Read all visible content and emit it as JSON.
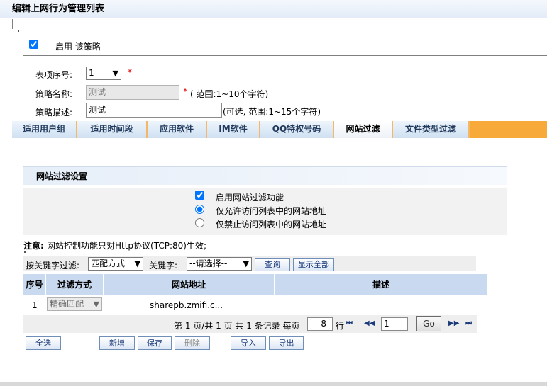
{
  "page": {
    "title": "编辑上网行为管理列表"
  },
  "policy": {
    "enable_checked": true,
    "enable_label": "启用 该策略",
    "index_label": "表项序号:",
    "index_value": "1",
    "required_mark": "*",
    "name_label": "策略名称:",
    "name_value": "测试",
    "name_hint": "( 范围:1~10个字符)",
    "desc_label": "策略描述:",
    "desc_value": "测试",
    "desc_hint": "(可选, 范围:1~15个字符)"
  },
  "tabs": [
    {
      "label": "适用用户组",
      "active": false
    },
    {
      "label": "适用时间段",
      "active": false
    },
    {
      "label": "应用软件",
      "active": false
    },
    {
      "label": "IM软件",
      "active": false
    },
    {
      "label": "QQ特权号码",
      "active": false
    },
    {
      "label": "网站过滤",
      "active": true
    },
    {
      "label": "文件类型过滤",
      "active": false
    }
  ],
  "filter": {
    "section_title": "网站过滤设置",
    "enable_label": "启用网站过滤功能",
    "enable_checked": true,
    "allow_label": "仅允许访问列表中的网站地址",
    "allow_selected": true,
    "deny_label": "仅禁止访问列表中的网站地址",
    "deny_selected": false,
    "note_label": "注意:",
    "note_text": "网站控制功能只对Http协议(TCP:80)生效;"
  },
  "search": {
    "keyword_filter_label": "按关键字过滤:",
    "match_mode": "匹配方式",
    "keyword_label": "关键字:",
    "keyword_value": "--请选择--",
    "query_button": "查询",
    "show_all_button": "显示全部"
  },
  "table": {
    "headers": [
      "序号",
      "过滤方式",
      "网站地址",
      "描述"
    ],
    "rows": [
      {
        "index": "1",
        "mode": "精确匹配",
        "url": "sharepb.zmifi.c...",
        "desc": ""
      }
    ]
  },
  "pager": {
    "summary": "第 1 页/共 1 页 共 1 条记录 每页",
    "per_page": "8",
    "rows_unit": "行",
    "current_page": "1",
    "go_button": "Go",
    "first": "⏮",
    "prev": "◀◀",
    "next": "▶▶",
    "last": "⏭"
  },
  "actions": {
    "select_all": "全选",
    "add": "新增",
    "save": "保存",
    "delete": "删除",
    "import": "导入",
    "export": "导出"
  }
}
